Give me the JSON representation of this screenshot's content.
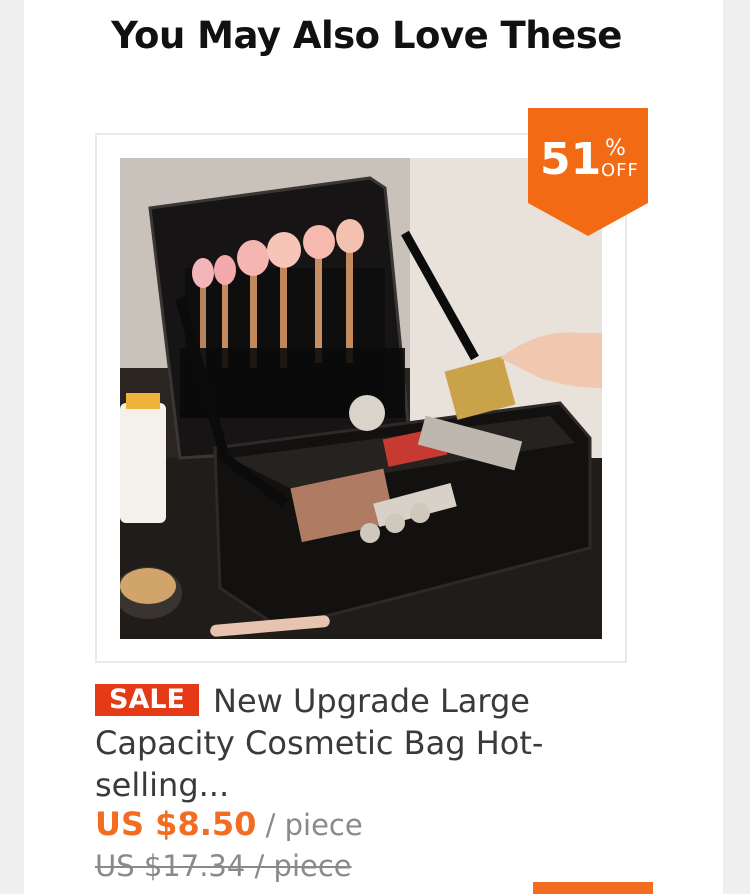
{
  "section": {
    "title": "You May Also Love These"
  },
  "product": {
    "image_alt": "Black cosmetic bag with makeup brushes and palettes",
    "discount": {
      "value": "51",
      "percent": "%",
      "off": "OFF"
    },
    "sale_tag": "SALE",
    "title": "New Upgrade Large Capacity Cosmetic Bag Hot-selling...",
    "price_current": "US $8.50",
    "price_unit": " / piece",
    "price_original": "US $17.34 / piece"
  },
  "colors": {
    "accent": "#f26d21",
    "sale": "#e53a15",
    "text": "#3a3a3a",
    "muted": "#8a8a8a"
  }
}
